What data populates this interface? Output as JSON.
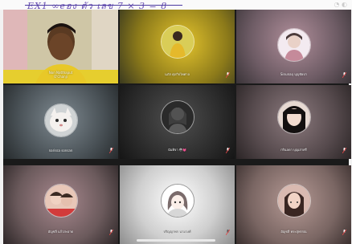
{
  "top": {
    "handwriting": "EX1  ∞eอง ตัว เลข 7 × 3 = 8"
  },
  "participants": [
    {
      "name": "Non Natthaput\nO'Chanji",
      "muted": false,
      "video": true
    },
    {
      "name": "นภัส ศุภกิจไพศาล",
      "muted": true
    },
    {
      "name": "Sinunaฤ บุญชัยปา",
      "muted": true
    },
    {
      "name": "narissa sonsan",
      "muted": true
    },
    {
      "name": "นันทิจา 😳💓",
      "muted": true
    },
    {
      "name": "กรินลดา บุญเสาศรี",
      "muted": true
    },
    {
      "name": "อัญชลี แก้วสะอาด",
      "muted": true
    },
    {
      "name": "ปริญญาพร นามวงศ์",
      "muted": true
    },
    {
      "name": "อัญชลี พระสุพรรณ",
      "muted": true
    }
  ],
  "colors": {
    "mic_muted": "#e64545",
    "tile_bg_dark": "#1a1a1a",
    "handwriting": "#6a4fb3"
  }
}
